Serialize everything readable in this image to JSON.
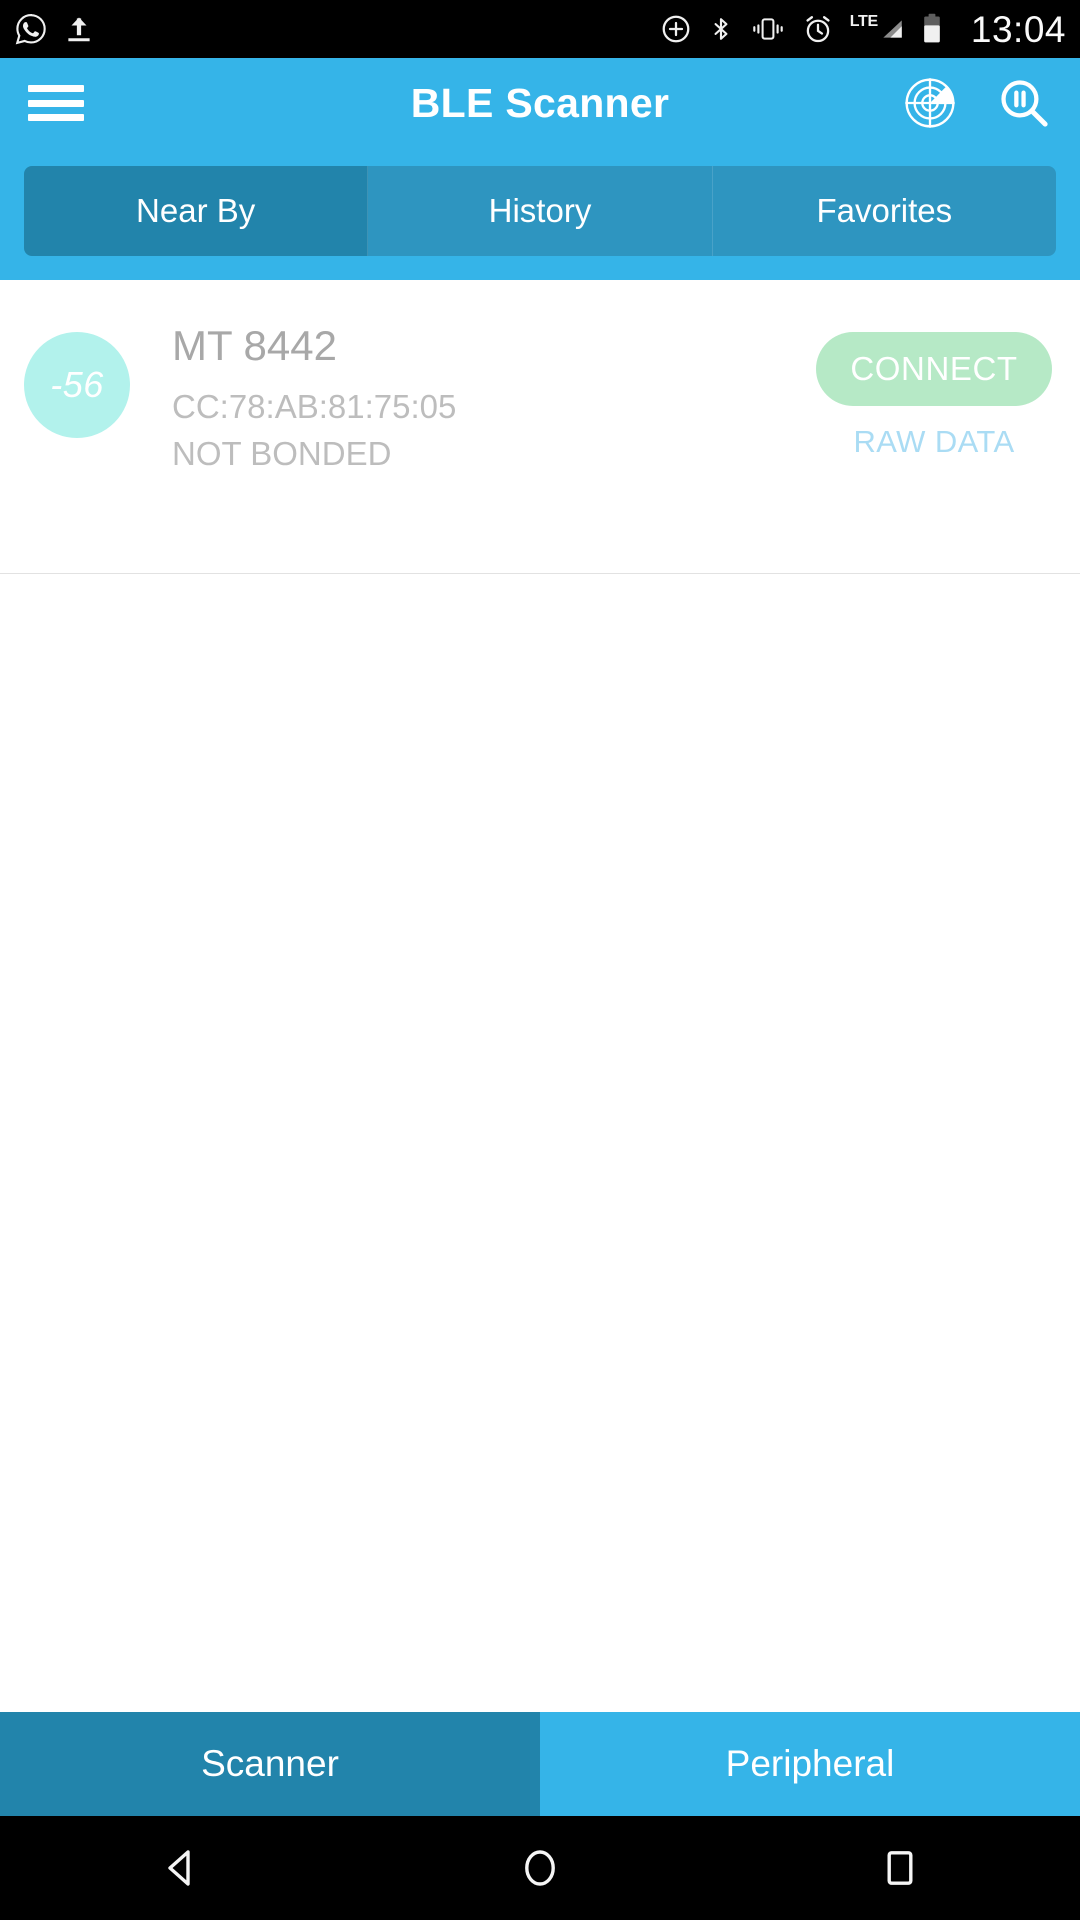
{
  "statusbar": {
    "time": "13:04",
    "lte_label": "LTE",
    "left_icons": [
      {
        "name": "whatsapp-icon"
      },
      {
        "name": "upload-icon"
      }
    ],
    "right_icons": [
      {
        "name": "add-account-icon"
      },
      {
        "name": "bluetooth-icon"
      },
      {
        "name": "vibrate-icon"
      },
      {
        "name": "alarm-icon"
      },
      {
        "name": "signal-lte-icon"
      },
      {
        "name": "battery-icon"
      }
    ]
  },
  "appbar": {
    "title": "BLE Scanner",
    "menu_icon": "hamburger-menu-icon",
    "radar_icon": "radar-scan-icon",
    "search_pause_icon": "search-pause-icon"
  },
  "tabs": {
    "items": [
      {
        "label": "Near By",
        "active": true
      },
      {
        "label": "History",
        "active": false
      },
      {
        "label": "Favorites",
        "active": false
      }
    ]
  },
  "devices": [
    {
      "rssi": "-56",
      "name": "MT 8442",
      "mac": "CC:78:AB:81:75:05",
      "bond_status": "NOT BONDED",
      "connect_label": "CONNECT",
      "raw_data_label": "RAW DATA"
    }
  ],
  "bottom_nav": {
    "items": [
      {
        "label": "Scanner",
        "active": true
      },
      {
        "label": "Peripheral",
        "active": false
      }
    ]
  },
  "navbar": {
    "back": "back-triangle-icon",
    "home": "home-circle-icon",
    "recents": "recents-square-icon"
  },
  "colors": {
    "primary": "#35b4e8",
    "primary_dark": "#2284ab",
    "tab_inactive": "#2e95c0",
    "rssi_bubble": "#b2f2ec",
    "connect_button": "#b6e9c6",
    "raw_data_link": "#aadcf4"
  }
}
